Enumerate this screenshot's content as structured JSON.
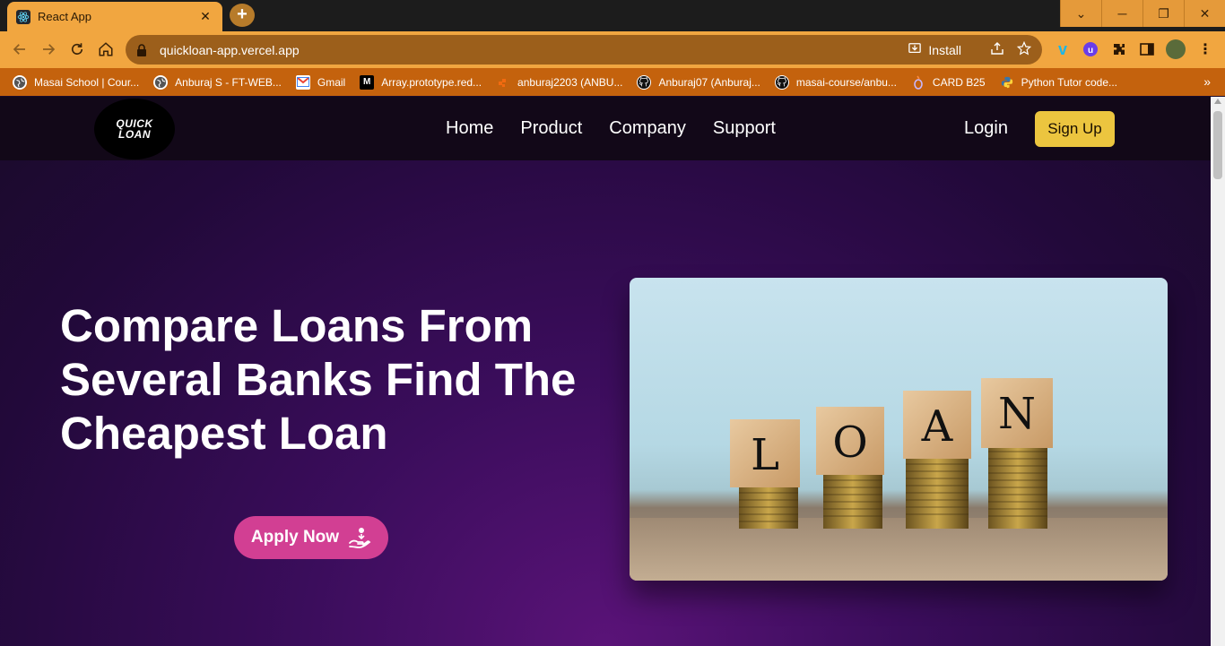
{
  "browser": {
    "tab_title": "React App",
    "tab_close": "✕",
    "new_tab": "+",
    "url": "quickloan-app.vercel.app",
    "install_label": "Install",
    "win_min": "─",
    "win_restore": "❐",
    "win_close": "✕",
    "win_chevron": "⌄"
  },
  "bookmarks": [
    {
      "label": "Masai School | Cour...",
      "icon": "globe-icon",
      "color": "#ffffff"
    },
    {
      "label": "Anburaj S - FT-WEB...",
      "icon": "globe-icon",
      "color": "#ffffff"
    },
    {
      "label": "Gmail",
      "icon": "gmail-icon",
      "color": "#ea4335"
    },
    {
      "label": "Array.prototype.red...",
      "icon": "mdn-icon",
      "color": "#000000"
    },
    {
      "label": "anburaj2203 (ANBU...",
      "icon": "orange-icon",
      "color": "#f26a10"
    },
    {
      "label": "Anburaj07 (Anburaj...",
      "icon": "github-icon",
      "color": "#000000"
    },
    {
      "label": "masai-course/anbu...",
      "icon": "github-icon",
      "color": "#000000"
    },
    {
      "label": "CARD B25",
      "icon": "card-icon",
      "color": "#6a5acd"
    },
    {
      "label": "Python Tutor code...",
      "icon": "python-icon",
      "color": "#3776ab"
    }
  ],
  "site": {
    "logo_top": "QUICK",
    "logo_bottom": "LOAN",
    "nav": [
      "Home",
      "Product",
      "Company",
      "Support"
    ],
    "login": "Login",
    "signup": "Sign Up",
    "hero_title": "Compare Loans From Several Banks Find The Cheapest Loan",
    "apply_label": "Apply Now",
    "image_letters": [
      "L",
      "O",
      "A",
      "N"
    ]
  },
  "colors": {
    "tab_accent": "#f1a640",
    "signup_bg": "#ecc53f",
    "apply_bg": "#d23f93"
  }
}
